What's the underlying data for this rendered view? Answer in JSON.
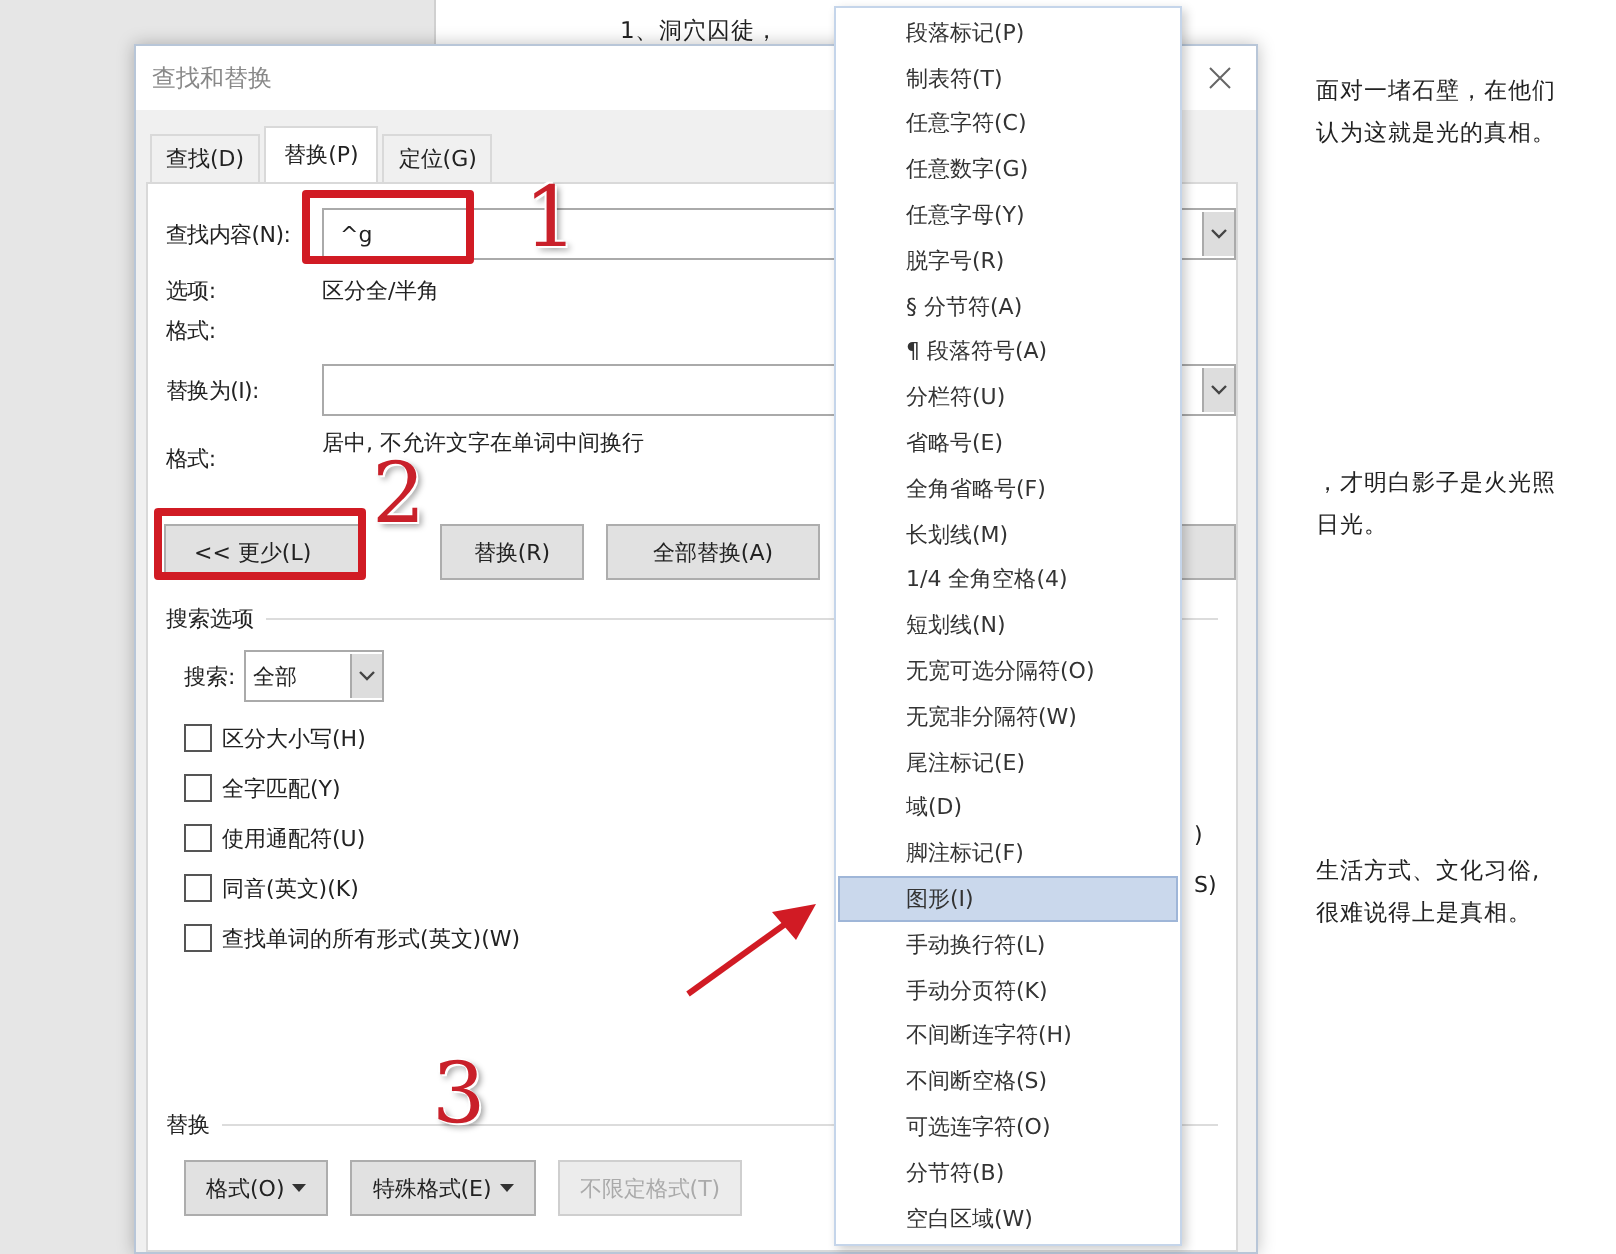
{
  "document": {
    "blocks": [
      {
        "lines": [
          "1、洞穴囚徒，"
        ]
      },
      {
        "lines": [
          "面对一堵石壁，在他们",
          "认为这就是光的真相。"
        ]
      },
      {
        "lines": [
          "，才明白影子是火光照",
          "日光。"
        ]
      },
      {
        "lines": [
          "生活方式、文化习俗,",
          "很难说得上是真相。"
        ]
      }
    ]
  },
  "dialog": {
    "title": "查找和替换",
    "tabs": [
      {
        "label": "查找(D)",
        "selected": false
      },
      {
        "label": "替换(P)",
        "selected": true
      },
      {
        "label": "定位(G)",
        "selected": false
      }
    ],
    "find": {
      "label": "查找内容(N):",
      "value": "^g",
      "options_label": "选项:",
      "options_value": "区分全/半角",
      "format_label": "格式:"
    },
    "replace": {
      "label": "替换为(I):",
      "format_label": "格式:",
      "format_value": "居中, 不允许文字在单词中间换行"
    },
    "buttons": [
      {
        "label": "<< 更少(L)"
      },
      {
        "label": "替换(R)"
      },
      {
        "label": "全部替换(A)"
      }
    ],
    "search_options": {
      "heading": "搜索选项",
      "search_label": "搜索:",
      "search_value": "全部",
      "checkboxes": [
        {
          "label": "区分大小写(H)",
          "checked": false
        },
        {
          "label": "全字匹配(Y)",
          "checked": false
        },
        {
          "label": "使用通配符(U)",
          "checked": false
        },
        {
          "label": "同音(英文)(K)",
          "checked": false
        },
        {
          "label": "查找单词的所有形式(英文)(W)",
          "checked": false
        }
      ],
      "right_fragments": [
        ")",
        "S)"
      ]
    },
    "replace_section": {
      "heading": "替换",
      "buttons": [
        {
          "label": "格式(O)",
          "dropdown": true,
          "disabled": false
        },
        {
          "label": "特殊格式(E)",
          "dropdown": true,
          "disabled": false
        },
        {
          "label": "不限定格式(T)",
          "dropdown": false,
          "disabled": true
        }
      ]
    }
  },
  "menu": {
    "items": [
      {
        "label": "段落标记(P)",
        "selected": false
      },
      {
        "label": "制表符(T)",
        "selected": false
      },
      {
        "label": "任意字符(C)",
        "selected": false
      },
      {
        "label": "任意数字(G)",
        "selected": false
      },
      {
        "label": "任意字母(Y)",
        "selected": false
      },
      {
        "label": "脱字号(R)",
        "selected": false
      },
      {
        "label": "§ 分节符(A)",
        "selected": false
      },
      {
        "label": "¶ 段落符号(A)",
        "selected": false
      },
      {
        "label": "分栏符(U)",
        "selected": false
      },
      {
        "label": "省略号(E)",
        "selected": false
      },
      {
        "label": "全角省略号(F)",
        "selected": false
      },
      {
        "label": "长划线(M)",
        "selected": false
      },
      {
        "label": "1/4 全角空格(4)",
        "selected": false
      },
      {
        "label": "短划线(N)",
        "selected": false
      },
      {
        "label": "无宽可选分隔符(O)",
        "selected": false
      },
      {
        "label": "无宽非分隔符(W)",
        "selected": false
      },
      {
        "label": "尾注标记(E)",
        "selected": false
      },
      {
        "label": "域(D)",
        "selected": false
      },
      {
        "label": "脚注标记(F)",
        "selected": false
      },
      {
        "label": "图形(I)",
        "selected": true
      },
      {
        "label": "手动换行符(L)",
        "selected": false
      },
      {
        "label": "手动分页符(K)",
        "selected": false
      },
      {
        "label": "不间断连字符(H)",
        "selected": false
      },
      {
        "label": "不间断空格(S)",
        "selected": false
      },
      {
        "label": "可选连字符(O)",
        "selected": false
      },
      {
        "label": "分节符(B)",
        "selected": false
      },
      {
        "label": "空白区域(W)",
        "selected": false
      }
    ]
  },
  "annotations": [
    {
      "number": "1"
    },
    {
      "number": "2"
    },
    {
      "number": "3"
    }
  ]
}
